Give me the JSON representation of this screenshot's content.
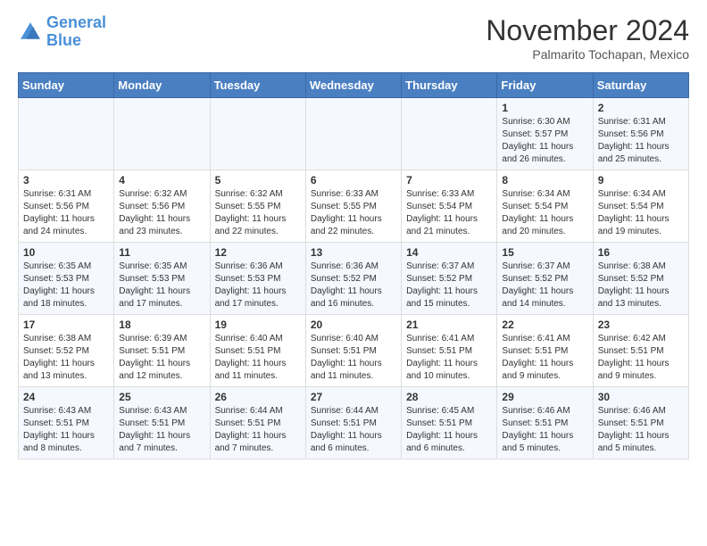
{
  "header": {
    "logo_line1": "General",
    "logo_line2": "Blue",
    "month": "November 2024",
    "location": "Palmarito Tochapan, Mexico"
  },
  "days_of_week": [
    "Sunday",
    "Monday",
    "Tuesday",
    "Wednesday",
    "Thursday",
    "Friday",
    "Saturday"
  ],
  "weeks": [
    [
      {
        "day": "",
        "info": ""
      },
      {
        "day": "",
        "info": ""
      },
      {
        "day": "",
        "info": ""
      },
      {
        "day": "",
        "info": ""
      },
      {
        "day": "",
        "info": ""
      },
      {
        "day": "1",
        "info": "Sunrise: 6:30 AM\nSunset: 5:57 PM\nDaylight: 11 hours and 26 minutes."
      },
      {
        "day": "2",
        "info": "Sunrise: 6:31 AM\nSunset: 5:56 PM\nDaylight: 11 hours and 25 minutes."
      }
    ],
    [
      {
        "day": "3",
        "info": "Sunrise: 6:31 AM\nSunset: 5:56 PM\nDaylight: 11 hours and 24 minutes."
      },
      {
        "day": "4",
        "info": "Sunrise: 6:32 AM\nSunset: 5:56 PM\nDaylight: 11 hours and 23 minutes."
      },
      {
        "day": "5",
        "info": "Sunrise: 6:32 AM\nSunset: 5:55 PM\nDaylight: 11 hours and 22 minutes."
      },
      {
        "day": "6",
        "info": "Sunrise: 6:33 AM\nSunset: 5:55 PM\nDaylight: 11 hours and 22 minutes."
      },
      {
        "day": "7",
        "info": "Sunrise: 6:33 AM\nSunset: 5:54 PM\nDaylight: 11 hours and 21 minutes."
      },
      {
        "day": "8",
        "info": "Sunrise: 6:34 AM\nSunset: 5:54 PM\nDaylight: 11 hours and 20 minutes."
      },
      {
        "day": "9",
        "info": "Sunrise: 6:34 AM\nSunset: 5:54 PM\nDaylight: 11 hours and 19 minutes."
      }
    ],
    [
      {
        "day": "10",
        "info": "Sunrise: 6:35 AM\nSunset: 5:53 PM\nDaylight: 11 hours and 18 minutes."
      },
      {
        "day": "11",
        "info": "Sunrise: 6:35 AM\nSunset: 5:53 PM\nDaylight: 11 hours and 17 minutes."
      },
      {
        "day": "12",
        "info": "Sunrise: 6:36 AM\nSunset: 5:53 PM\nDaylight: 11 hours and 17 minutes."
      },
      {
        "day": "13",
        "info": "Sunrise: 6:36 AM\nSunset: 5:52 PM\nDaylight: 11 hours and 16 minutes."
      },
      {
        "day": "14",
        "info": "Sunrise: 6:37 AM\nSunset: 5:52 PM\nDaylight: 11 hours and 15 minutes."
      },
      {
        "day": "15",
        "info": "Sunrise: 6:37 AM\nSunset: 5:52 PM\nDaylight: 11 hours and 14 minutes."
      },
      {
        "day": "16",
        "info": "Sunrise: 6:38 AM\nSunset: 5:52 PM\nDaylight: 11 hours and 13 minutes."
      }
    ],
    [
      {
        "day": "17",
        "info": "Sunrise: 6:38 AM\nSunset: 5:52 PM\nDaylight: 11 hours and 13 minutes."
      },
      {
        "day": "18",
        "info": "Sunrise: 6:39 AM\nSunset: 5:51 PM\nDaylight: 11 hours and 12 minutes."
      },
      {
        "day": "19",
        "info": "Sunrise: 6:40 AM\nSunset: 5:51 PM\nDaylight: 11 hours and 11 minutes."
      },
      {
        "day": "20",
        "info": "Sunrise: 6:40 AM\nSunset: 5:51 PM\nDaylight: 11 hours and 11 minutes."
      },
      {
        "day": "21",
        "info": "Sunrise: 6:41 AM\nSunset: 5:51 PM\nDaylight: 11 hours and 10 minutes."
      },
      {
        "day": "22",
        "info": "Sunrise: 6:41 AM\nSunset: 5:51 PM\nDaylight: 11 hours and 9 minutes."
      },
      {
        "day": "23",
        "info": "Sunrise: 6:42 AM\nSunset: 5:51 PM\nDaylight: 11 hours and 9 minutes."
      }
    ],
    [
      {
        "day": "24",
        "info": "Sunrise: 6:43 AM\nSunset: 5:51 PM\nDaylight: 11 hours and 8 minutes."
      },
      {
        "day": "25",
        "info": "Sunrise: 6:43 AM\nSunset: 5:51 PM\nDaylight: 11 hours and 7 minutes."
      },
      {
        "day": "26",
        "info": "Sunrise: 6:44 AM\nSunset: 5:51 PM\nDaylight: 11 hours and 7 minutes."
      },
      {
        "day": "27",
        "info": "Sunrise: 6:44 AM\nSunset: 5:51 PM\nDaylight: 11 hours and 6 minutes."
      },
      {
        "day": "28",
        "info": "Sunrise: 6:45 AM\nSunset: 5:51 PM\nDaylight: 11 hours and 6 minutes."
      },
      {
        "day": "29",
        "info": "Sunrise: 6:46 AM\nSunset: 5:51 PM\nDaylight: 11 hours and 5 minutes."
      },
      {
        "day": "30",
        "info": "Sunrise: 6:46 AM\nSunset: 5:51 PM\nDaylight: 11 hours and 5 minutes."
      }
    ]
  ]
}
